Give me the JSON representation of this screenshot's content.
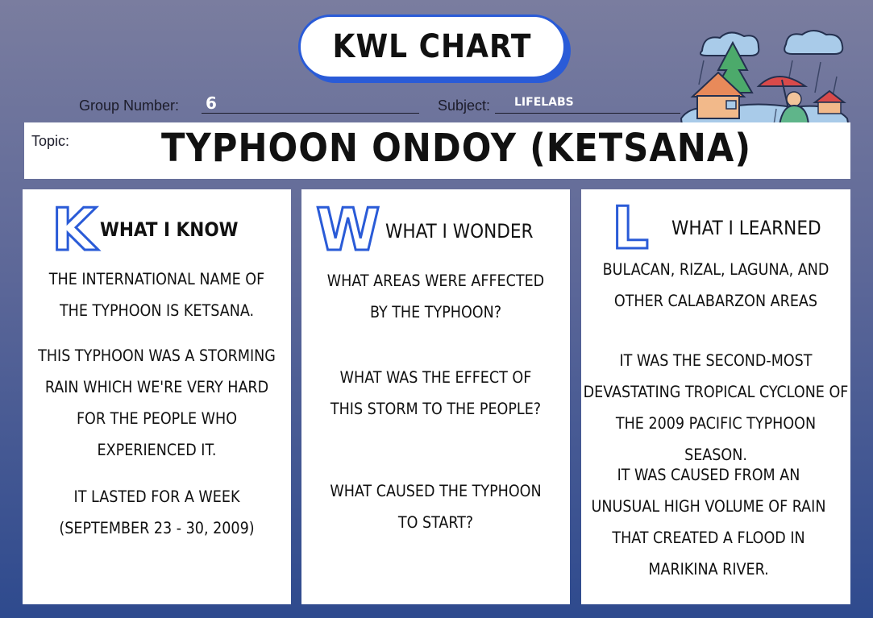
{
  "title": "KWL CHART",
  "group": {
    "label": "Group Number:",
    "value": "6"
  },
  "subject": {
    "label": "Subject:",
    "value": "LIFELABS"
  },
  "topic": {
    "label": "Topic:",
    "value": "TYPHOON ONDOY (KETSANA)"
  },
  "columns": [
    {
      "letter": "K",
      "heading": "WHAT I KNOW",
      "entries": [
        "THE INTERNATIONAL NAME OF THE TYPHOON IS KETSANA.",
        "THIS TYPHOON WAS A STORMING RAIN WHICH WE'RE VERY HARD FOR THE PEOPLE WHO EXPERIENCED IT.",
        "IT LASTED FOR A WEEK (SEPTEMBER 23 - 30, 2009)"
      ]
    },
    {
      "letter": "W",
      "heading": "WHAT I WONDER",
      "entries": [
        "WHAT AREAS WERE AFFECTED BY THE TYPHOON?",
        "WHAT WAS THE EFFECT OF THIS STORM TO THE PEOPLE?",
        "WHAT CAUSED THE TYPHOON TO START?"
      ]
    },
    {
      "letter": "L",
      "heading": "WHAT I LEARNED",
      "entries": [
        "BULACAN, RIZAL, LAGUNA, AND OTHER CALABARZON AREAS",
        "IT WAS THE SECOND-MOST DEVASTATING TROPICAL CYCLONE OF THE 2009 PACIFIC TYPHOON SEASON.",
        "IT WAS CAUSED FROM AN UNUSUAL HIGH VOLUME OF RAIN THAT CREATED A FLOOD IN MARIKINA RIVER."
      ]
    }
  ],
  "colors": {
    "accent": "#2a5bd7",
    "background_top": "#7a7d9f",
    "background_bottom": "#2e4a8e",
    "panel": "#ffffff"
  }
}
